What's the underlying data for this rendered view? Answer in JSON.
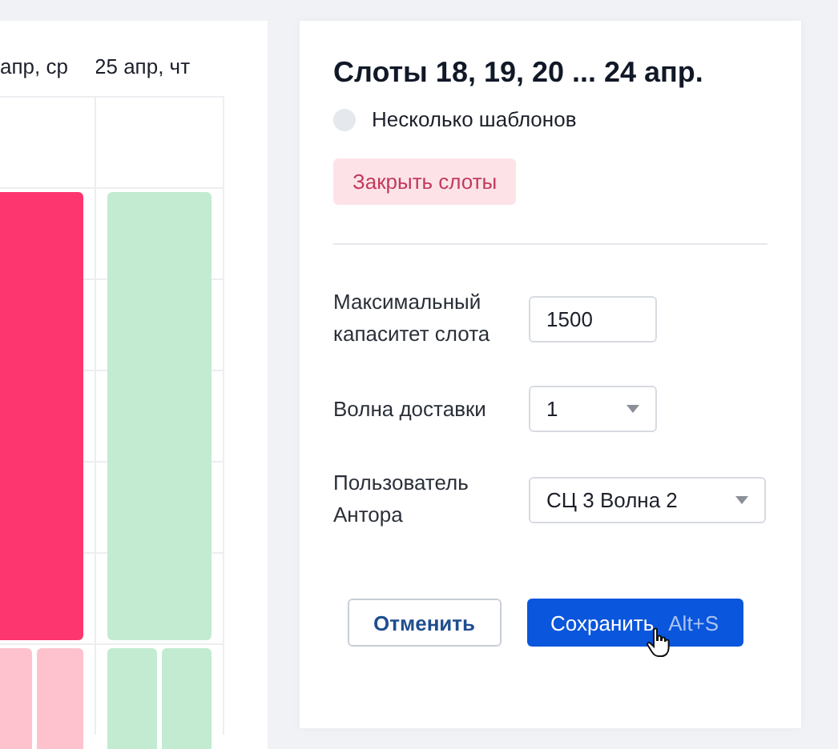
{
  "calendar": {
    "columns": [
      {
        "header": "апр, ср",
        "slots": [
          {
            "kind": "large",
            "color": "#fe366f"
          },
          {
            "kind": "small",
            "color": "#fdc2cd"
          },
          {
            "kind": "small",
            "color": "#fdc2cd"
          }
        ]
      },
      {
        "header": "25 апр, чт",
        "slots": [
          {
            "kind": "large",
            "color": "#c2ebd2"
          },
          {
            "kind": "small",
            "color": "#c2ebd2"
          },
          {
            "kind": "small",
            "color": "#c2ebd2"
          }
        ]
      }
    ]
  },
  "panel": {
    "title": "Слоты 18, 19, 20 ... 24 апр.",
    "option": {
      "label": "Несколько шаблонов",
      "checked": false
    },
    "close_button": "Закрыть слоты",
    "fields": [
      {
        "kind": "input",
        "label": "Максимальный капаситет слота",
        "value": "1500"
      },
      {
        "kind": "select",
        "label": "Волна доставки",
        "value": "1"
      },
      {
        "kind": "select",
        "label": "Пользователь Антора",
        "value": "СЦ 3 Волна 2"
      }
    ],
    "cancel_button": "Отменить",
    "save_button": {
      "label": "Сохранить",
      "shortcut": "Alt+S"
    }
  }
}
